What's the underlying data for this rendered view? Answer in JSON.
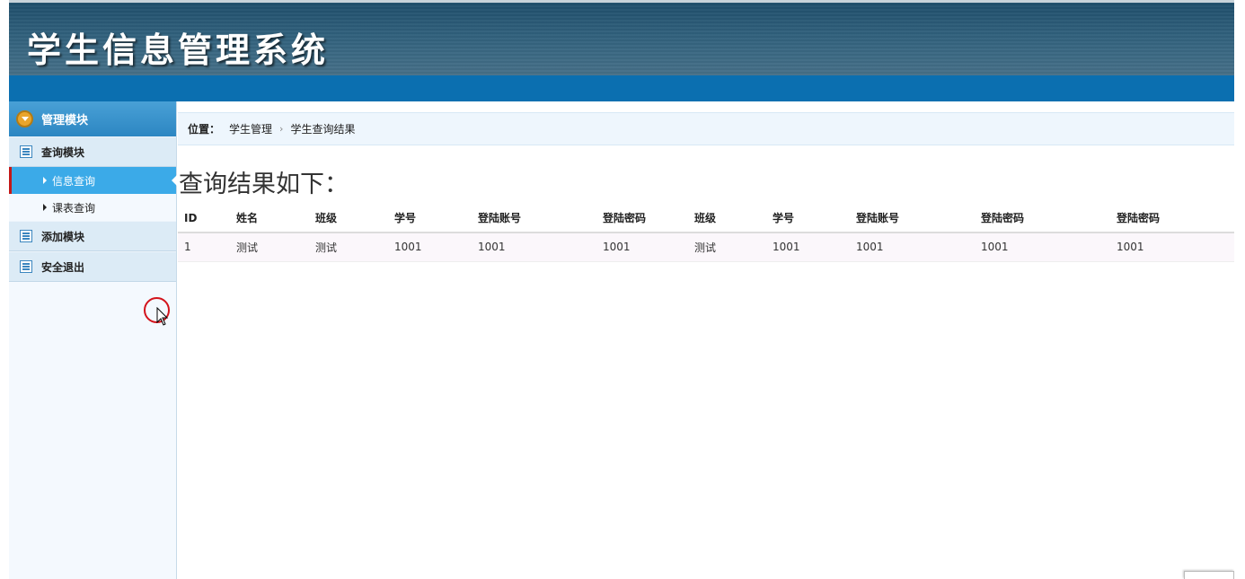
{
  "header": {
    "title": "学生信息管理系统"
  },
  "sidebar": {
    "section_title": "管理模块",
    "groups": [
      {
        "label": "查询模块",
        "items": [
          {
            "label": "信息查询",
            "active": true
          },
          {
            "label": "课表查询",
            "active": false
          }
        ]
      },
      {
        "label": "添加模块",
        "items": []
      },
      {
        "label": "安全退出",
        "items": []
      }
    ]
  },
  "breadcrumb": {
    "label": "位置：",
    "items": [
      "学生管理",
      "学生查询结果"
    ]
  },
  "main": {
    "result_title": "查询结果如下："
  },
  "table": {
    "columns": [
      "ID",
      "姓名",
      "班级",
      "学号",
      "登陆账号",
      "登陆密码",
      "班级",
      "学号",
      "登陆账号",
      "登陆密码",
      "登陆密码"
    ],
    "rows": [
      [
        "1",
        "测试",
        "测试",
        "1001",
        "1001",
        "1001",
        "测试",
        "1001",
        "1001",
        "1001",
        "1001"
      ]
    ]
  },
  "colors": {
    "header_bg": "#2f5f7b",
    "nav_strip": "#0b6fb0",
    "active_item": "#3baae8",
    "active_marker": "#c31818"
  }
}
